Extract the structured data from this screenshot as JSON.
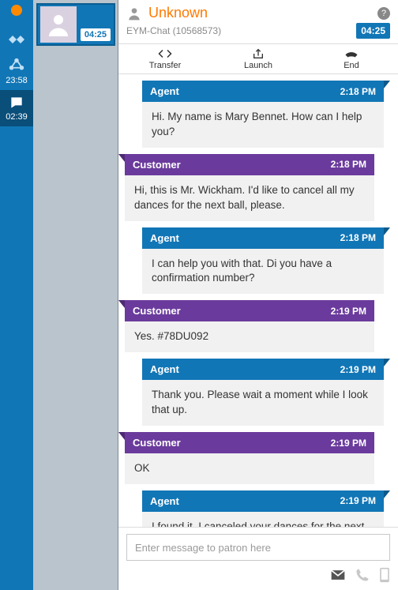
{
  "rail": {
    "handshake_time": "",
    "links_time": "23:58",
    "chat_time": "02:39"
  },
  "session": {
    "timer": "04:25"
  },
  "header": {
    "name": "Unknown",
    "channel": "EYM-Chat (10568573)",
    "elapsed": "04:25"
  },
  "toolbar": {
    "transfer": "Transfer",
    "launch": "Launch",
    "end": "End"
  },
  "roles": {
    "agent": "Agent",
    "customer": "Customer"
  },
  "messages": [
    {
      "role": "agent",
      "time": "2:18 PM",
      "text": "Hi. My name is Mary Bennet. How can I help you?"
    },
    {
      "role": "customer",
      "time": "2:18 PM",
      "text": "Hi, this is Mr. Wickham. I'd like to cancel all my dances for the next ball, please."
    },
    {
      "role": "agent",
      "time": "2:18 PM",
      "text": "I can help you with that. Di you have a confirmation number?"
    },
    {
      "role": "customer",
      "time": "2:19 PM",
      "text": "Yes. #78DU092"
    },
    {
      "role": "agent",
      "time": "2:19 PM",
      "text": "Thank you. Please wait a moment while I look that up."
    },
    {
      "role": "customer",
      "time": "2:19 PM",
      "text": "OK"
    },
    {
      "role": "agent",
      "time": "2:19 PM",
      "text": "I found it. I canceled your dances for the next ball at the social hall. Can I help you with anything else today?"
    }
  ],
  "composer": {
    "placeholder": "Enter message to patron here"
  }
}
